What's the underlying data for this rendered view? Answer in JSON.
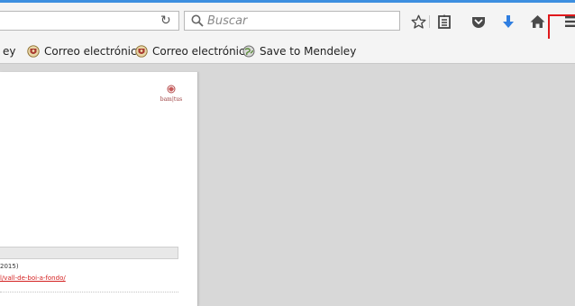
{
  "toolbar": {
    "search_placeholder": "Buscar",
    "icons": [
      "reload-icon",
      "search-icon",
      "star-icon",
      "reading-list-icon",
      "pocket-icon",
      "download-icon",
      "home-icon",
      "menu-icon"
    ],
    "colors": {
      "accent": "#3d8fe0",
      "download": "#2f7ee0",
      "highlight": "#e0181b"
    }
  },
  "bookmarks": {
    "items": [
      {
        "label": "ey",
        "icon": ""
      },
      {
        "label": "Correo electrónico",
        "icon": "crest-icon"
      },
      {
        "label": "Correo electrónico",
        "icon": "crest-icon"
      },
      {
        "label": "Save to Mendeley",
        "icon": "globe-icon"
      }
    ]
  },
  "document": {
    "logo_text": "bam|tus",
    "year_text": "2015)",
    "link_text": "l/vall-de-boi-a-fondo/"
  }
}
